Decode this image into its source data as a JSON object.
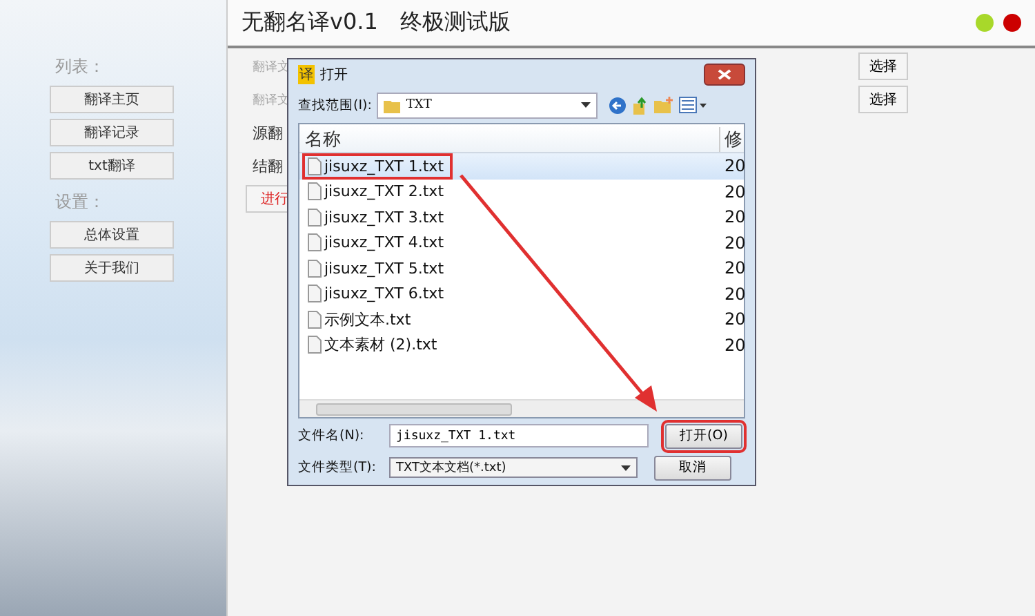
{
  "window": {
    "title": "无翻名译v0.1　终极测试版"
  },
  "sidebar": {
    "sections": [
      {
        "heading": "列表：",
        "items": [
          "翻译主页",
          "翻译记录",
          "txt翻译"
        ]
      },
      {
        "heading": "设置：",
        "items": [
          "总体设置",
          "关于我们"
        ]
      }
    ]
  },
  "content": {
    "rows": [
      {
        "label": "翻译文",
        "button": "选择",
        "faint": true
      },
      {
        "label": "翻译文",
        "button": "选择",
        "faint": true
      },
      {
        "label": "源翻",
        "faint": false
      },
      {
        "label": "结翻",
        "faint": false
      }
    ],
    "action_button": "进行"
  },
  "dialog": {
    "title_icon": "译",
    "title": "打开",
    "look_in_label": "查找范围(I):",
    "folder": "TXT",
    "columns": [
      "名称",
      "修"
    ],
    "files": [
      {
        "name": "jisuxz_TXT 1.txt",
        "date": "20",
        "selected": true,
        "annotated": true
      },
      {
        "name": "jisuxz_TXT 2.txt",
        "date": "20",
        "selected": false,
        "annotated": false
      },
      {
        "name": "jisuxz_TXT 3.txt",
        "date": "20",
        "selected": false,
        "annotated": false
      },
      {
        "name": "jisuxz_TXT 4.txt",
        "date": "20",
        "selected": false,
        "annotated": false
      },
      {
        "name": "jisuxz_TXT 5.txt",
        "date": "20",
        "selected": false,
        "annotated": false
      },
      {
        "name": "jisuxz_TXT 6.txt",
        "date": "20",
        "selected": false,
        "annotated": false
      },
      {
        "name": "示例文本.txt",
        "date": "20",
        "selected": false,
        "annotated": false
      },
      {
        "name": "文本素材 (2).txt",
        "date": "20",
        "selected": false,
        "annotated": false
      }
    ],
    "filename_label": "文件名(N):",
    "filename": "jisuxz_TXT 1.txt",
    "filetype_label": "文件类型(T):",
    "filetype": "TXT文本文档(*.txt)",
    "buttons": [
      {
        "label": "打开(O)",
        "annotated": true
      },
      {
        "label": "取消",
        "annotated": false
      }
    ]
  }
}
